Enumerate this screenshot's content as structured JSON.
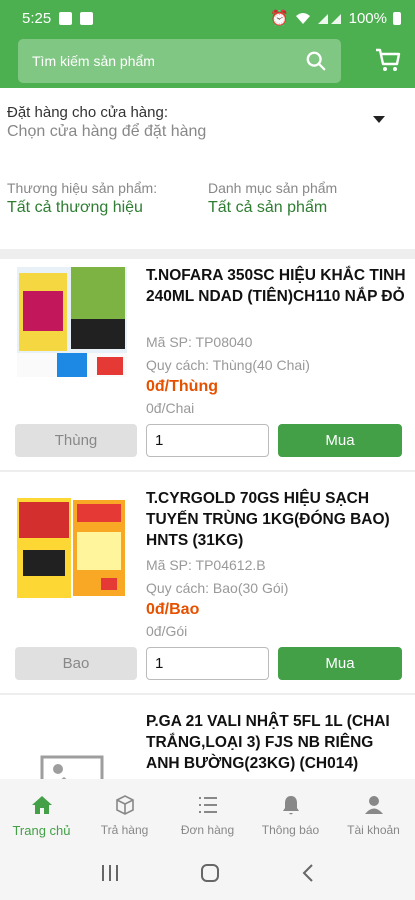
{
  "status_bar": {
    "time": "5:25",
    "battery": "100%"
  },
  "search": {
    "placeholder": "Tìm kiếm sản phẩm"
  },
  "store": {
    "label": "Đặt hàng cho cửa hàng:",
    "value": "Chọn cửa hàng để đặt hàng"
  },
  "filters": {
    "brand_label": "Thương hiệu sản phẩm:",
    "brand_value": "Tất cả thương hiệu",
    "category_label": "Danh mục sản phẩm",
    "category_value": "Tất cả sản phẩm"
  },
  "products": [
    {
      "name": "T.NOFARA 350SC HIỆU KHẮC TINH 240ML NDAD (TIÊN)CH110 NẮP ĐỎ",
      "code": "Mã SP: TP08040",
      "spec": "Quy cách: Thùng(40 Chai)",
      "price": "0đ/Thùng",
      "sub_price": "0đ/Chai",
      "unit": "Thùng",
      "qty": "1",
      "buy": "Mua"
    },
    {
      "name": "T.CYRGOLD 70GS HIỆU SẠCH TUYẾN TRÙNG 1KG(ĐÓNG BAO) HNTS (31KG)",
      "code": "Mã SP: TP04612.B",
      "spec": "Quy cách: Bao(30 Gói)",
      "price": "0đ/Bao",
      "sub_price": "0đ/Gói",
      "unit": "Bao",
      "qty": "1",
      "buy": "Mua"
    },
    {
      "name": "P.GA 21 VALI NHẬT 5FL 1L (CHAI TRẮNG,LOẠI 3) FJS NB RIÊNG ANH BƯỜNG(23KG) (CH014)"
    }
  ],
  "bottom_nav": [
    {
      "label": "Trang chủ",
      "icon": "home-icon"
    },
    {
      "label": "Trả hàng",
      "icon": "return-box-icon"
    },
    {
      "label": "Đơn hàng",
      "icon": "order-list-icon"
    },
    {
      "label": "Thông báo",
      "icon": "bell-icon"
    },
    {
      "label": "Tài khoản",
      "icon": "person-icon"
    }
  ],
  "colors": {
    "primary": "#4caf50",
    "buy_button": "#43a047",
    "price": "#e65100",
    "link": "#2e7d32"
  }
}
